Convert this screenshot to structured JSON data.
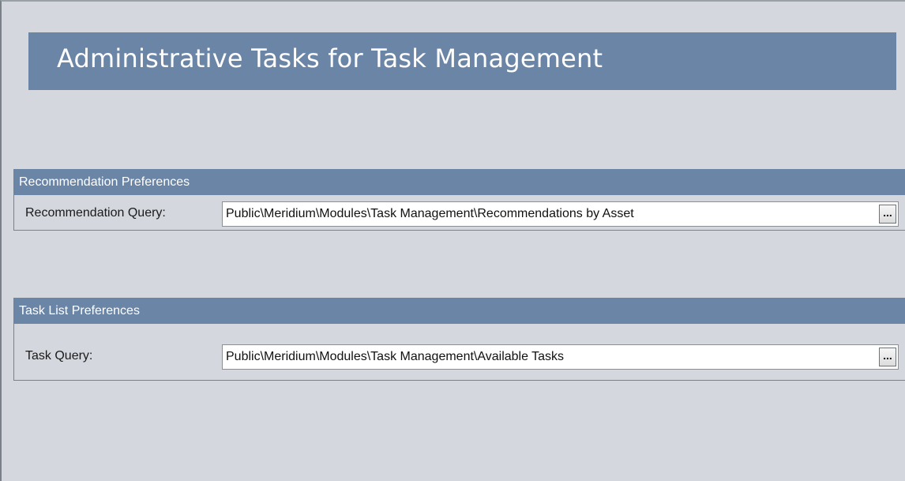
{
  "title": "Administrative Tasks for Task Management",
  "recommendation_section": {
    "header": "Recommendation Preferences",
    "field_label": "Recommendation Query:",
    "field_value": "Public\\Meridium\\Modules\\Task Management\\Recommendations by Asset",
    "browse_label": "..."
  },
  "task_section": {
    "header": "Task List Preferences",
    "field_label": "Task Query:",
    "field_value": "Public\\Meridium\\Modules\\Task Management\\Available Tasks",
    "browse_label": "..."
  },
  "colors": {
    "background": "#d4d8de",
    "header_blue": "#6a85a6",
    "text_white": "#ffffff"
  }
}
